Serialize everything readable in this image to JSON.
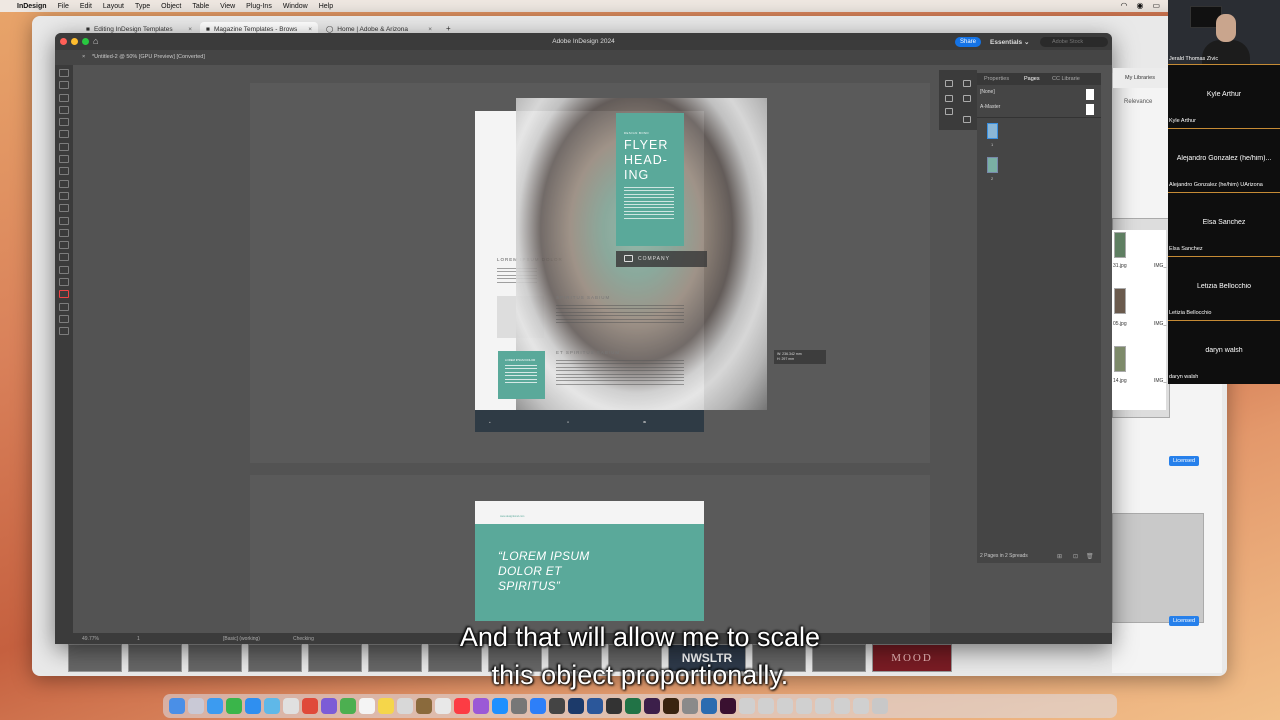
{
  "menubar": {
    "app_name": "InDesign",
    "items": [
      "File",
      "Edit",
      "Layout",
      "Type",
      "Object",
      "Table",
      "View",
      "Plug-Ins",
      "Window",
      "Help"
    ]
  },
  "browser": {
    "tabs": [
      {
        "label": "Editing InDesign Templates"
      },
      {
        "label": "Magazine Templates - Brows"
      },
      {
        "label": "Home | Adobe & Arizona"
      }
    ],
    "new_tab": "+",
    "nwsltr": "NWSLTR",
    "mood": "MOOD",
    "licensed": "Licensed",
    "relevance": "Relevance",
    "files": [
      "31.jpg",
      "05.jpg",
      "14.jpg"
    ],
    "file_prefix": "IMG_"
  },
  "indesign": {
    "title": "Adobe InDesign 2024",
    "share_label": "Share",
    "workspace_label": "Essentials",
    "stock_placeholder": "Adobe Stock",
    "doc_tab": "*Untitled-2 @ 50% [GPU Preview] [Converted]",
    "doc_close": "×"
  },
  "layout": {
    "flyer_kicker": "DESIGN BOND",
    "flyer_heading": [
      "FLYER",
      "HEAD-",
      "ING"
    ],
    "company": "COMPANY",
    "lorem_heading": "LOREM IPSUM DOLOR",
    "spiritus_heading": "SPIRITUS SABIUM",
    "et_heading": "ET SPIRITUS SABIUM",
    "green_box_title": "LOREM IPSUM DOLOR",
    "measure": [
      "W: 236.342 mm",
      "H: 297 mm"
    ],
    "page2_url": "www.designbond.com",
    "page2_quote": [
      "“LOREM IPSUM",
      "DOLOR ET",
      "SPIRITUS”"
    ]
  },
  "statusbar": {
    "zoom": "49.77%",
    "page": "1",
    "preflight_profile": "[Basic] (working)",
    "preflight_status": "Checking"
  },
  "panels": {
    "tabs": [
      "Properties",
      "Pages",
      "CC Librarie"
    ],
    "active_tab": "Pages",
    "none_master": "[None]",
    "a_master": "A-Master",
    "page_numbers": [
      "1",
      "2"
    ],
    "footer": "2 Pages in 2 Spreads",
    "libraries_label": "My Libraries"
  },
  "zoom": {
    "self_name": "Jerald Thomas Zivic",
    "participants": [
      {
        "display": "Kyle Arthur",
        "tag": "Kyle Arthur"
      },
      {
        "display": "Alejandro Gonzalez (he/him)...",
        "tag": "Alejandro Gonzalez (he/him) UArizona"
      },
      {
        "display": "Elsa Sanchez",
        "tag": "Elsa Sanchez"
      },
      {
        "display": "Letizia Bellocchio",
        "tag": "Letizia Bellocchio"
      },
      {
        "display": "daryn walsh",
        "tag": "daryn walsh"
      }
    ]
  },
  "caption": {
    "line1": "And that will allow me to scale",
    "line2": "this object proportionally."
  },
  "colors": {
    "teal": "#5aa99a",
    "share_blue": "#1473e6",
    "zoom_border": "#c58b35"
  }
}
